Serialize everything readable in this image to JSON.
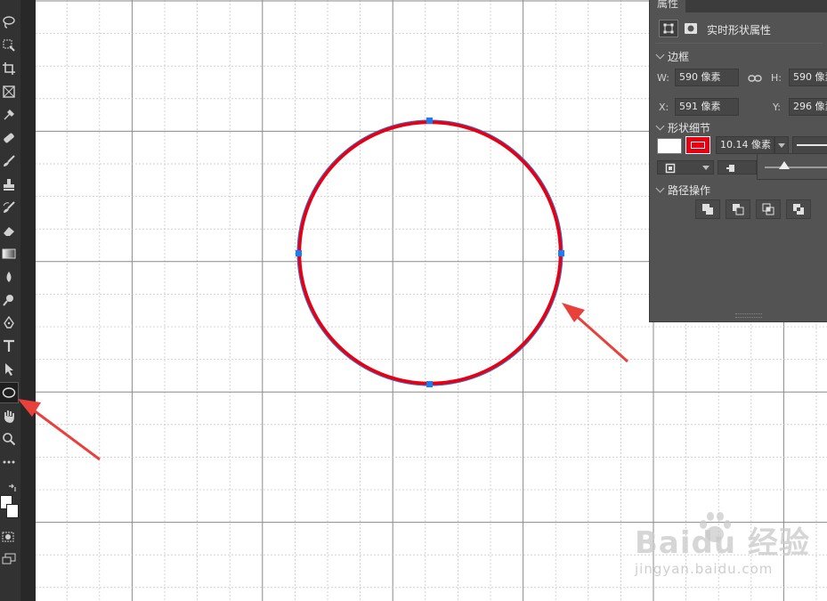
{
  "toolbar": {
    "tools": [
      {
        "name": "lasso-tool-icon",
        "glyph": "lasso"
      },
      {
        "name": "quick-select-tool-icon",
        "glyph": "select"
      },
      {
        "name": "crop-tool-icon",
        "glyph": "crop"
      },
      {
        "name": "frame-tool-icon",
        "glyph": "frame"
      },
      {
        "name": "eyedropper-tool-icon",
        "glyph": "eyedropper"
      },
      {
        "name": "healing-brush-tool-icon",
        "glyph": "bandage"
      },
      {
        "name": "brush-tool-icon",
        "glyph": "brush"
      },
      {
        "name": "clone-stamp-tool-icon",
        "glyph": "stamp"
      },
      {
        "name": "history-brush-tool-icon",
        "glyph": "history"
      },
      {
        "name": "eraser-tool-icon",
        "glyph": "eraser"
      },
      {
        "name": "gradient-tool-icon",
        "glyph": "gradient"
      },
      {
        "name": "blur-tool-icon",
        "glyph": "drop"
      },
      {
        "name": "dodge-tool-icon",
        "glyph": "dodge"
      },
      {
        "name": "pen-tool-icon",
        "glyph": "pen"
      },
      {
        "name": "type-tool-icon",
        "glyph": "T"
      },
      {
        "name": "path-selection-tool-icon",
        "glyph": "arrow"
      },
      {
        "name": "ellipse-tool-icon",
        "glyph": "ellipse",
        "active": true
      },
      {
        "name": "hand-tool-icon",
        "glyph": "hand"
      },
      {
        "name": "zoom-tool-icon",
        "glyph": "zoom"
      },
      {
        "name": "more-tools-icon",
        "glyph": "dots"
      }
    ]
  },
  "panel": {
    "tab_label": "属性",
    "header_label": "实时形状属性",
    "sections": {
      "bounds": "边框",
      "shape_details": "形状细节",
      "path_ops": "路径操作"
    },
    "bounds": {
      "w_label": "W:",
      "w_value": "590 像素",
      "h_label": "H:",
      "h_value": "590 像素",
      "x_label": "X:",
      "x_value": "591 像素",
      "y_label": "Y:",
      "y_value": "296 像素"
    },
    "stroke": {
      "width_value": "10.14 像素",
      "fill_color": "#ffffff",
      "stroke_color": "#e60012"
    }
  },
  "canvas": {
    "shape": "circle",
    "stroke_color": "#e60012",
    "path_color": "#3a6fd8",
    "annotation_color": "#e8413c"
  },
  "watermark": {
    "logo_text": "Baidu 经验",
    "url": "jingyan.baidu.com"
  }
}
